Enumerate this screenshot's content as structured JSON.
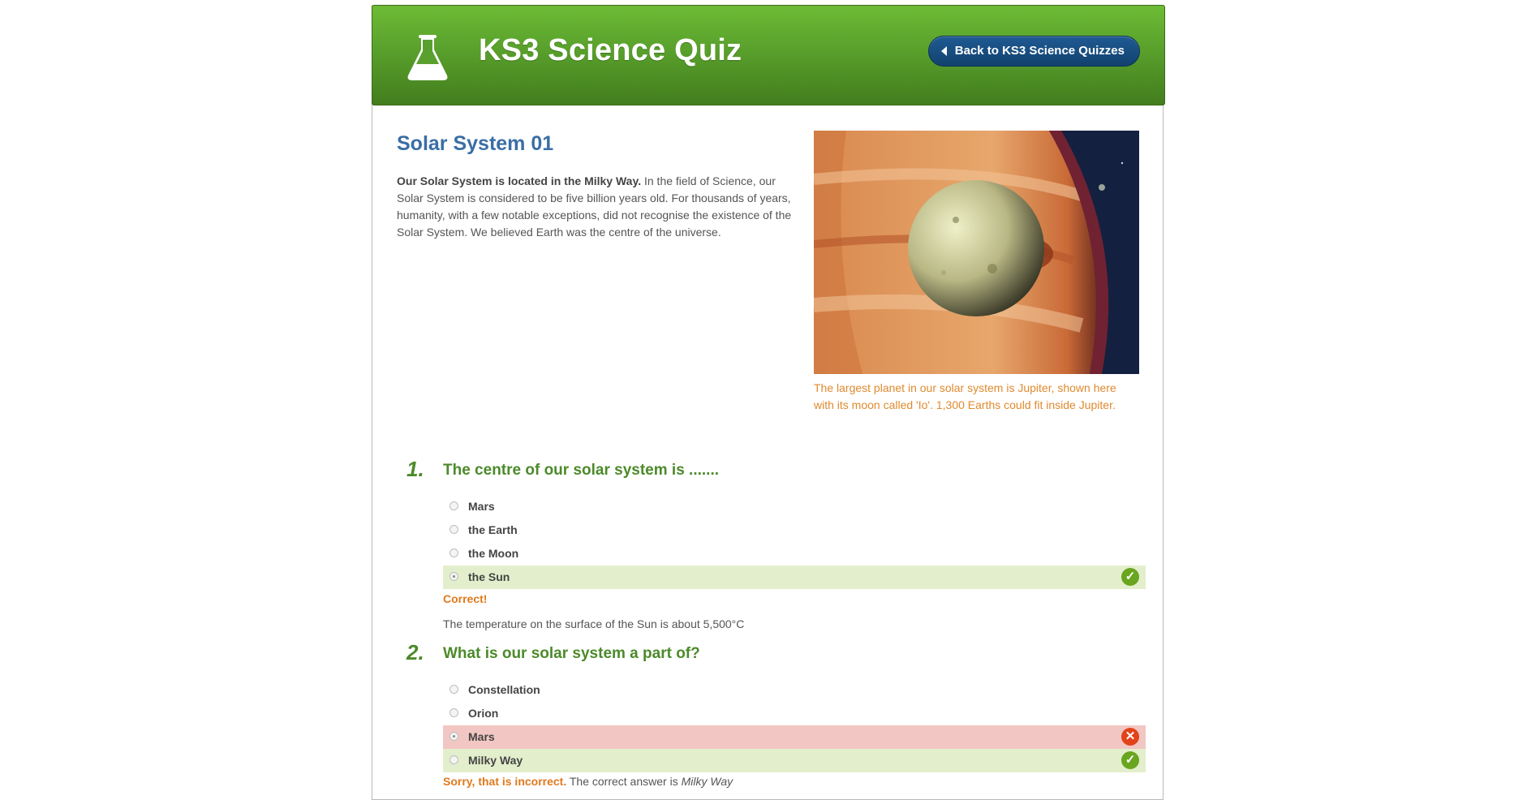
{
  "header": {
    "title": "KS3 Science Quiz",
    "back_button": "Back to KS3 Science Quizzes",
    "logo_icon": "flask-icon"
  },
  "quiz": {
    "title": "Solar System 01",
    "intro_bold": "Our Solar System is located in the Milky Way.",
    "intro_rest": " In the field of Science, our Solar System is considered to be five billion years old. For thousands of years, humanity, with a few notable exceptions, did not recognise the existence of the Solar System. We believed Earth was the centre of the universe.",
    "image_caption": "The largest planet in our solar system is Jupiter, shown here with its moon called 'Io'. 1,300 Earths could fit inside Jupiter."
  },
  "questions": [
    {
      "number": "1.",
      "text": "The centre of our solar system is .......",
      "options": [
        {
          "label": "Mars",
          "state": "none",
          "selected": false
        },
        {
          "label": "the Earth",
          "state": "none",
          "selected": false
        },
        {
          "label": "the Moon",
          "state": "none",
          "selected": false
        },
        {
          "label": "the Sun",
          "state": "correct",
          "selected": true
        }
      ],
      "feedback": "Correct!",
      "note": "The temperature on the surface of the Sun is about 5,500°C"
    },
    {
      "number": "2.",
      "text": "What is our solar system a part of?",
      "options": [
        {
          "label": "Constellation",
          "state": "none",
          "selected": false
        },
        {
          "label": "Orion",
          "state": "none",
          "selected": false
        },
        {
          "label": "Mars",
          "state": "incorrect",
          "selected": true
        },
        {
          "label": "Milky Way",
          "state": "correct",
          "selected": false
        }
      ],
      "feedback": "Sorry, that is incorrect.",
      "feedback_rest": " The correct answer is ",
      "correct_answer": "Milky Way"
    }
  ],
  "colors": {
    "header_green": "#59a02c",
    "title_blue": "#3a6ea5",
    "question_green": "#4c8a2a",
    "caption_orange": "#e08a2e",
    "correct_bg": "#e3efcc",
    "incorrect_bg": "#f2c7c3"
  }
}
